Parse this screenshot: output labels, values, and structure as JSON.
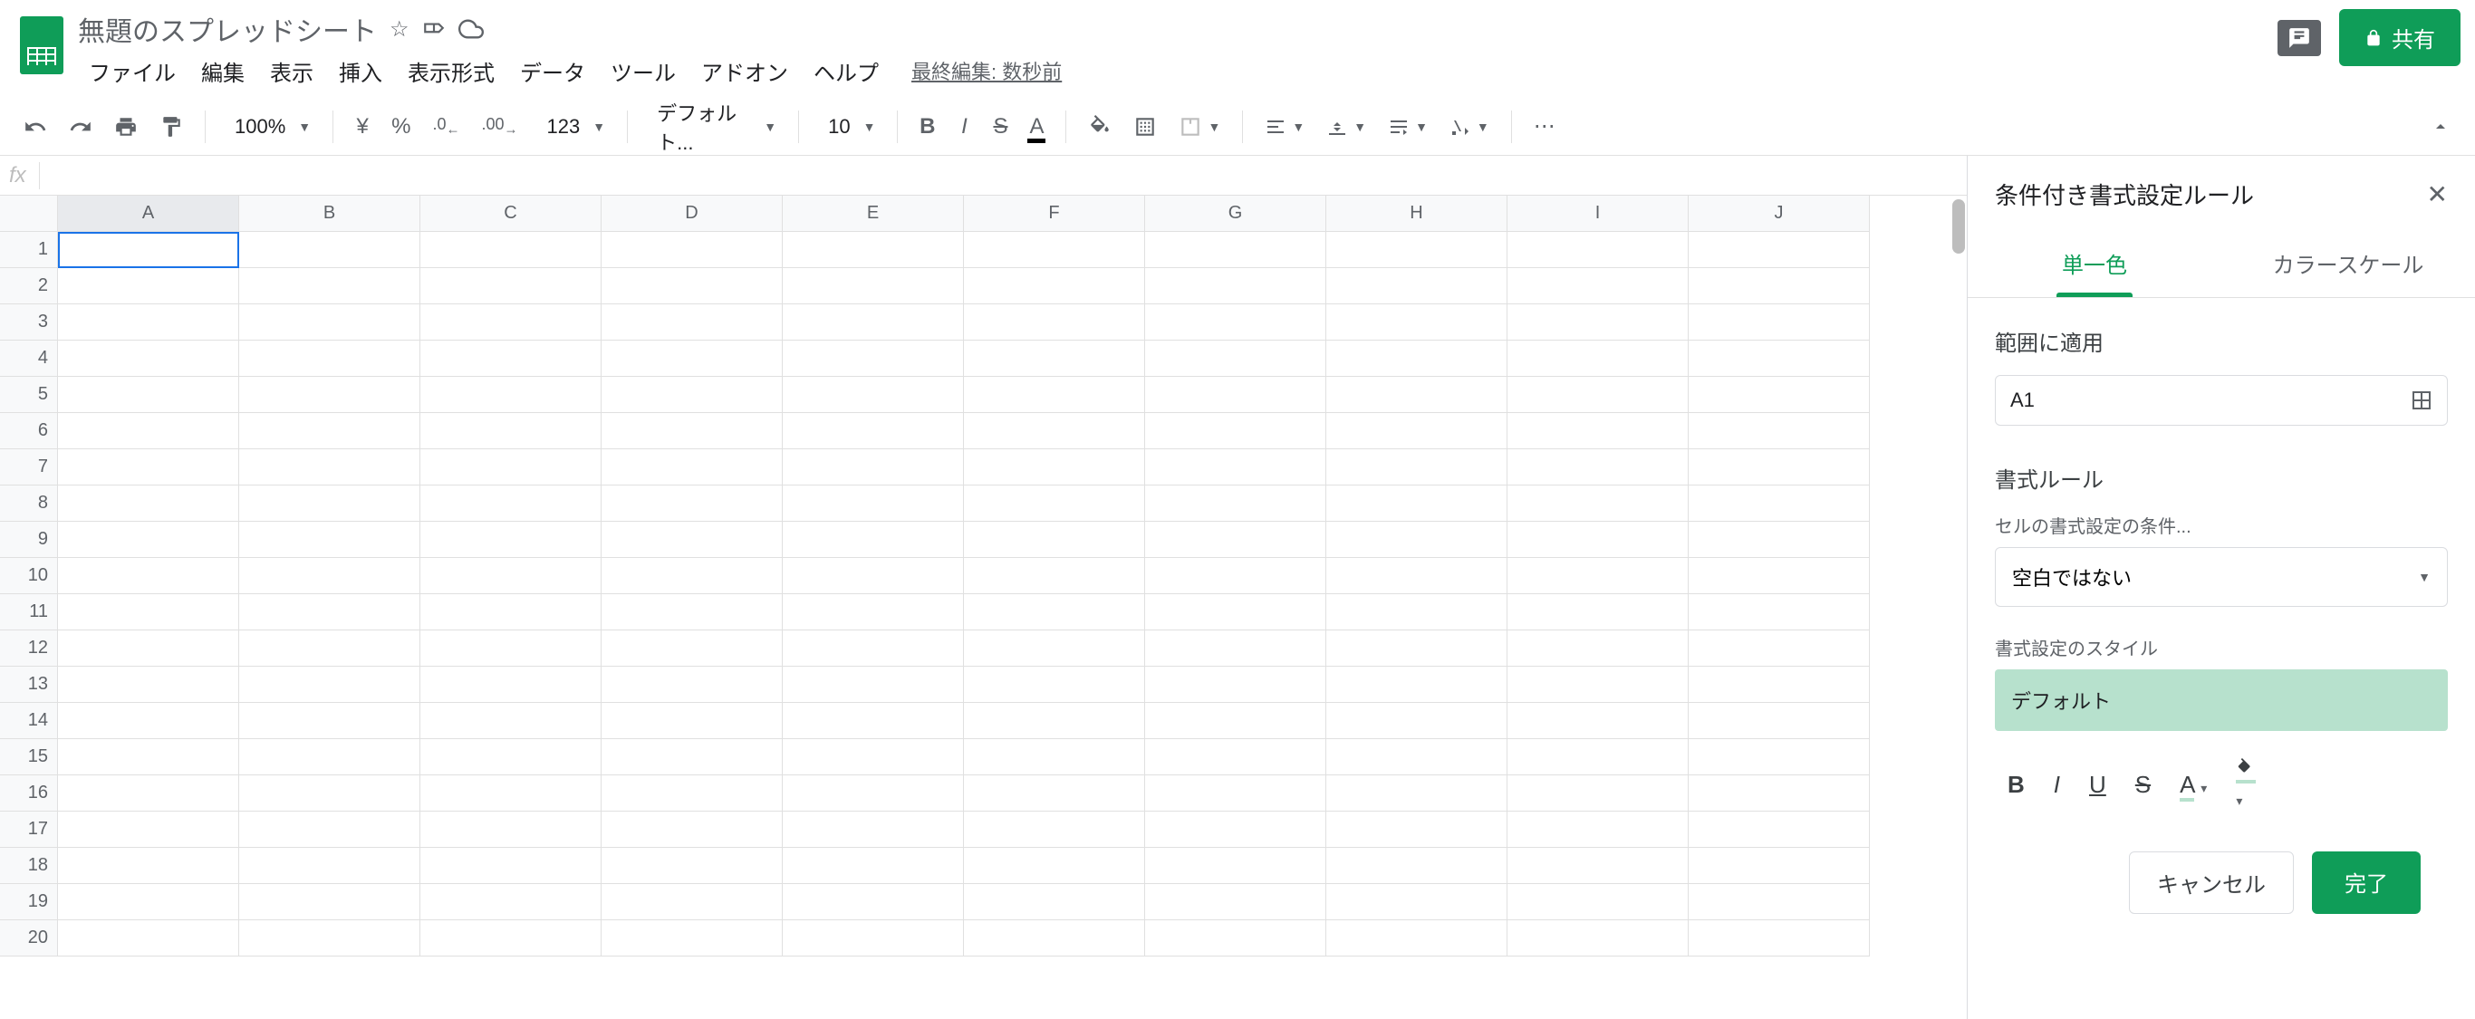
{
  "header": {
    "title": "無題のスプレッドシート",
    "last_edit": "最終編集: 数秒前",
    "share_label": "共有"
  },
  "menu": {
    "file": "ファイル",
    "edit": "編集",
    "view": "表示",
    "insert": "挿入",
    "format": "表示形式",
    "data": "データ",
    "tools": "ツール",
    "addons": "アドオン",
    "help": "ヘルプ"
  },
  "toolbar": {
    "zoom": "100%",
    "currency": "¥",
    "percent": "%",
    "dec_decrease": ".0",
    "dec_increase": ".00",
    "more_formats": "123",
    "font": "デフォルト...",
    "font_size": "10"
  },
  "formula_bar": {
    "fx": "fx",
    "value": ""
  },
  "grid": {
    "columns": [
      "A",
      "B",
      "C",
      "D",
      "E",
      "F",
      "G",
      "H",
      "I",
      "J"
    ],
    "rows": [
      "1",
      "2",
      "3",
      "4",
      "5",
      "6",
      "7",
      "8",
      "9",
      "10",
      "11",
      "12",
      "13",
      "14",
      "15",
      "16",
      "17",
      "18",
      "19",
      "20"
    ],
    "active_col": "A",
    "selected_cell": "A1"
  },
  "sidebar": {
    "title": "条件付き書式設定ルール",
    "tabs": {
      "single": "単一色",
      "scale": "カラースケール"
    },
    "range_label": "範囲に適用",
    "range_value": "A1",
    "rules_label": "書式ルール",
    "condition_sublabel": "セルの書式設定の条件...",
    "condition_value": "空白ではない",
    "style_sublabel": "書式設定のスタイル",
    "style_preview": "デフォルト",
    "cancel": "キャンセル",
    "done": "完了"
  }
}
